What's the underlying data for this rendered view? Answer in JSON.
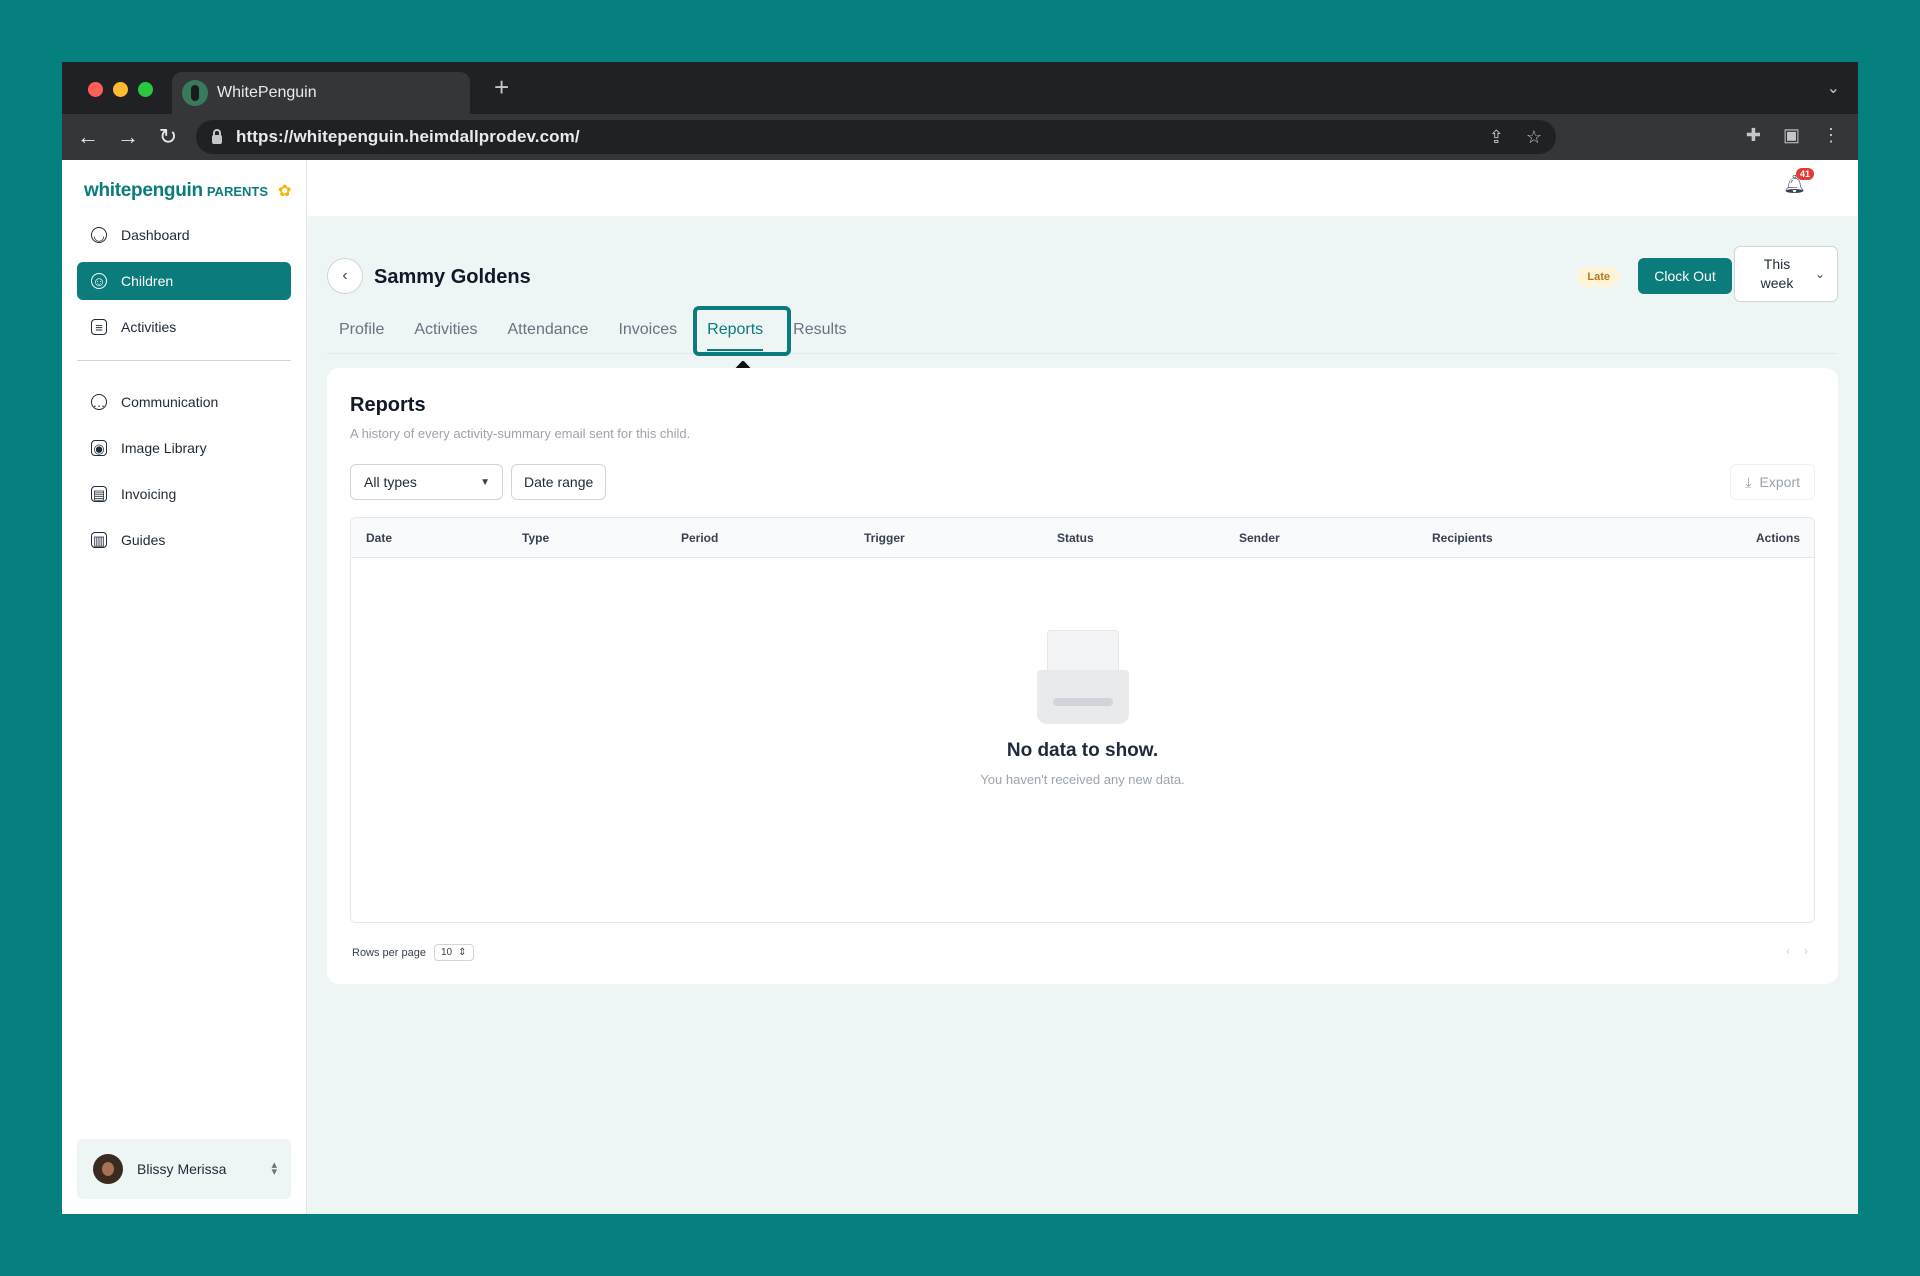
{
  "browser": {
    "tab_title": "WhitePenguin",
    "new_tab": "+",
    "url": "https://whitepenguin.heimdallprodev.com/"
  },
  "brand": {
    "name": "whitepenguin",
    "suffix": "PARENTS"
  },
  "sidebar": {
    "items": [
      {
        "label": "Dashboard",
        "icon": "dashboard-icon",
        "active": false
      },
      {
        "label": "Children",
        "icon": "children-icon",
        "active": true
      },
      {
        "label": "Activities",
        "icon": "activities-icon",
        "active": false
      },
      {
        "label": "Communication",
        "icon": "chat-icon",
        "active": false
      },
      {
        "label": "Image Library",
        "icon": "camera-icon",
        "active": false
      },
      {
        "label": "Invoicing",
        "icon": "invoice-icon",
        "active": false
      },
      {
        "label": "Guides",
        "icon": "book-icon",
        "active": false
      }
    ],
    "user": {
      "name": "Blissy Merissa"
    }
  },
  "topbar": {
    "notification_count": "41"
  },
  "header": {
    "child_name": "Sammy Goldens",
    "status_badge": "Late",
    "clock_button": "Clock Out",
    "period_line1": "This",
    "period_line2": "week"
  },
  "tabs": [
    "Profile",
    "Activities",
    "Attendance",
    "Invoices",
    "Reports",
    "Results"
  ],
  "active_tab": "Reports",
  "reports": {
    "title": "Reports",
    "subtitle": "A history of every activity-summary email sent for this child.",
    "filter_type": "All types",
    "filter_date": "Date range",
    "export_label": "Export",
    "columns": [
      "Date",
      "Type",
      "Period",
      "Trigger",
      "Status",
      "Sender",
      "Recipients",
      "Actions"
    ],
    "empty_title": "No data to show.",
    "empty_subtitle": "You haven't received any new data.",
    "rows_per_page_label": "Rows per page",
    "rows_per_page": "10"
  },
  "colors": {
    "accent": "#0b7c7b",
    "background": "#067f7f",
    "late_badge": "#fdf3d6",
    "notification": "#e53935"
  }
}
